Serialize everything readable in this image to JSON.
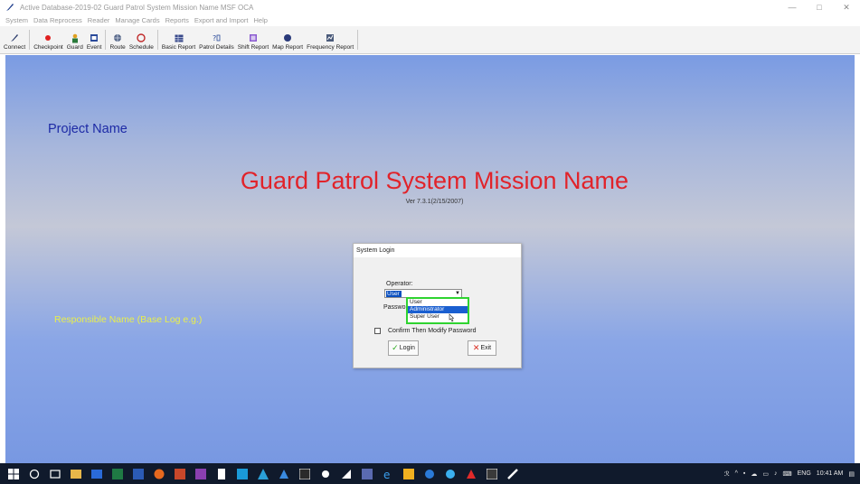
{
  "window": {
    "title": "Active Database-2019-02 Guard Patrol System Mission Name MSF OCA",
    "minimize": "—",
    "maximize": "□",
    "close": "✕"
  },
  "menu": [
    "System",
    "Data Reprocess",
    "Reader",
    "Manage Cards",
    "Reports",
    "Export and Import",
    "Help"
  ],
  "toolbar": {
    "connect": "Connect",
    "checkpoint": "Checkpoint",
    "guard": "Guard",
    "event": "Event",
    "route": "Route",
    "schedule": "Schedule",
    "basic_report": "Basic Report",
    "patrol_details": "Patrol Details",
    "shift_report": "Shift Report",
    "map_report": "Map Report",
    "frequency_report": "Frequency Report"
  },
  "main": {
    "project_name": "Project Name",
    "mission_name": "Guard Patrol System Mission Name",
    "version": "Ver 7.3.1(2/15/2007)",
    "responsible": "Responsible Name (Base Log e.g.)",
    "colors": {
      "project_name": "#1d2aa6",
      "mission_name": "#e1232a",
      "responsible": "#e9ef4a"
    }
  },
  "login": {
    "title": "System Login",
    "operator_label": "Operator:",
    "operator_value": "User",
    "password_label": "Passwor",
    "options": [
      "User",
      "Administrator",
      "Super User"
    ],
    "highlighted_option": "Administrator",
    "confirm_label": "Confirm Then Modify Password",
    "login_button": "Login",
    "exit_button": "Exit"
  },
  "taskbar": {
    "tray_language": "ENG",
    "tray_time": "10:41 AM"
  }
}
